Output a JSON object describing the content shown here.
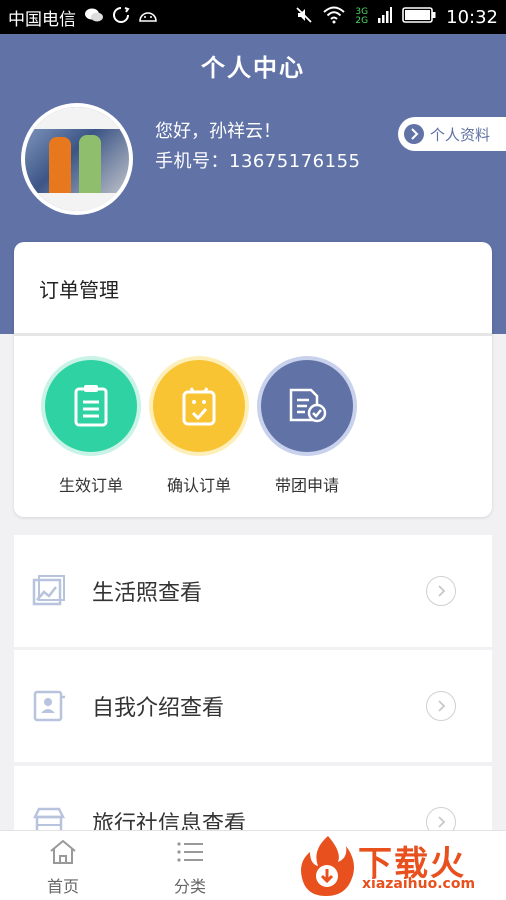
{
  "status_bar": {
    "carrier": "中国电信",
    "net_top": "3G",
    "net_bottom": "2G",
    "time": "10:32"
  },
  "header": {
    "title": "个人中心",
    "greeting": "您好，孙祥云！",
    "phone": "手机号：13675176155",
    "profile_link": "个人资料",
    "bg_color": "#6072a6"
  },
  "orders": {
    "title": "订单管理",
    "items": [
      {
        "label": "生效订单",
        "color": "#2fd2a3",
        "icon": "clipboard-icon"
      },
      {
        "label": "确认订单",
        "color": "#f8c433",
        "icon": "confirm-bag-icon"
      },
      {
        "label": "带团申请",
        "color": "#6072a6",
        "icon": "document-check-icon"
      }
    ]
  },
  "list": [
    {
      "label": "生活照查看",
      "icon": "photo-icon"
    },
    {
      "label": "自我介绍查看",
      "icon": "profile-card-icon"
    },
    {
      "label": "旅行社信息查看",
      "icon": "shop-icon"
    }
  ],
  "bottom_nav": [
    {
      "label": "首页",
      "icon": "home-icon"
    },
    {
      "label": "分类",
      "icon": "list-icon"
    }
  ],
  "watermark": {
    "title": "下载火",
    "site": "xiazaihuo.com"
  }
}
